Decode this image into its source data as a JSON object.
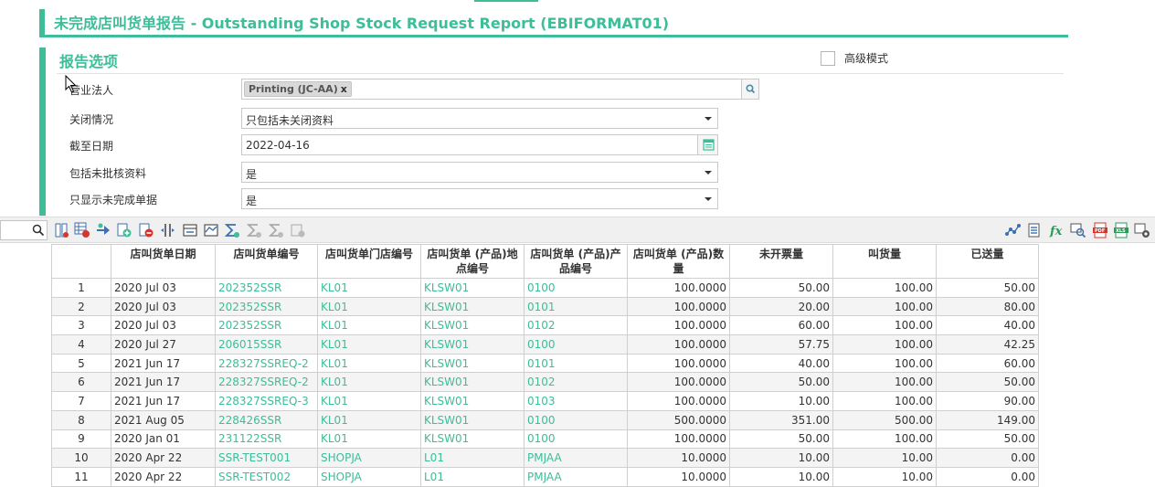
{
  "report": {
    "title": "未完成店叫货单报告 - Outstanding Shop Stock Request Report (EBIFORMAT01)"
  },
  "options": {
    "section_title": "报告选项",
    "advanced_mode_label": "高级模式",
    "advanced_mode_checked": false,
    "legal_entity": {
      "label": "营业法人",
      "tag": "Printing (JC-AA)",
      "tag_remove": "x"
    },
    "close_status": {
      "label": "关闭情况",
      "value": "只包括未关闭资料"
    },
    "as_of_date": {
      "label": "截至日期",
      "value": "2022-04-16"
    },
    "include_unapproved": {
      "label": "包括未批核资料",
      "value": "是"
    },
    "only_incomplete": {
      "label": "只显示未完成单据",
      "value": "是"
    }
  },
  "toolbar": {
    "left_icons": [
      "search-icon",
      "column-icon",
      "grid-remove-icon",
      "run-icon",
      "add-sheet-icon",
      "delete-sheet-icon",
      "split-column-icon",
      "freeze-icon",
      "chart-header-icon",
      "sum-icon",
      "sum-disabled-icon",
      "sum-all-disabled-icon",
      "export-disabled-icon"
    ],
    "right_icons": [
      "graph-icon",
      "report-icon",
      "formula-icon",
      "preview-icon",
      "pdf-icon",
      "xls-icon",
      "settings-icon"
    ]
  },
  "table": {
    "columns": [
      "",
      "店叫货单日期",
      "店叫货单编号",
      "店叫货单门店编号",
      "店叫货单 (产品)地点编号",
      "店叫货单 (产品)产品编号",
      "店叫货单 (产品)数量",
      "未开票量",
      "叫货量",
      "已送量"
    ],
    "rows": [
      [
        "1",
        "2020 Jul 03",
        "202352SSR",
        "KL01",
        "KLSW01",
        "0100",
        "100.0000",
        "50.00",
        "100.00",
        "50.00"
      ],
      [
        "2",
        "2020 Jul 03",
        "202352SSR",
        "KL01",
        "KLSW01",
        "0101",
        "100.0000",
        "20.00",
        "100.00",
        "80.00"
      ],
      [
        "3",
        "2020 Jul 03",
        "202352SSR",
        "KL01",
        "KLSW01",
        "0102",
        "100.0000",
        "60.00",
        "100.00",
        "40.00"
      ],
      [
        "4",
        "2020 Jul 27",
        "206015SSR",
        "KL01",
        "KLSW01",
        "0100",
        "100.0000",
        "57.75",
        "100.00",
        "42.25"
      ],
      [
        "5",
        "2021 Jun 17",
        "228327SSREQ-2",
        "KL01",
        "KLSW01",
        "0101",
        "100.0000",
        "40.00",
        "100.00",
        "60.00"
      ],
      [
        "6",
        "2021 Jun 17",
        "228327SSREQ-2",
        "KL01",
        "KLSW01",
        "0102",
        "100.0000",
        "50.00",
        "100.00",
        "50.00"
      ],
      [
        "7",
        "2021 Jun 17",
        "228327SSREQ-3",
        "KL01",
        "KLSW01",
        "0103",
        "100.0000",
        "10.00",
        "100.00",
        "90.00"
      ],
      [
        "8",
        "2021 Aug 05",
        "228426SSR",
        "KL01",
        "KLSW01",
        "0100",
        "500.0000",
        "351.00",
        "500.00",
        "149.00"
      ],
      [
        "9",
        "2020 Jan 01",
        "231122SSR",
        "KL01",
        "KLSW01",
        "0100",
        "100.0000",
        "50.00",
        "100.00",
        "50.00"
      ],
      [
        "10",
        "2020 Apr 22",
        "SSR-TEST001",
        "SHOPJA",
        "L01",
        "PMJAA",
        "10.0000",
        "10.00",
        "10.00",
        "0.00"
      ],
      [
        "11",
        "2020 Apr 22",
        "SSR-TEST002",
        "SHOPJA",
        "L01",
        "PMJAA",
        "10.0000",
        "10.00",
        "10.00",
        "0.00"
      ]
    ]
  },
  "colors": {
    "accent": "#3dbd98",
    "link": "#3dbd98",
    "pdf": "#d9342b",
    "xls": "#2e9a5a"
  }
}
